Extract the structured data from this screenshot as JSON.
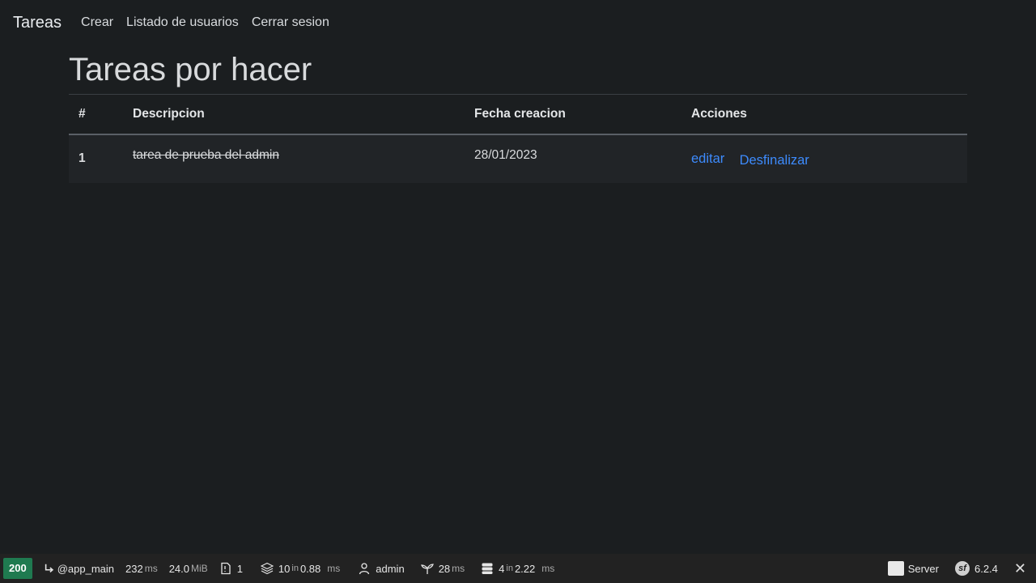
{
  "navbar": {
    "brand": "Tareas",
    "links": [
      "Crear",
      "Listado de usuarios",
      "Cerrar sesion"
    ]
  },
  "main": {
    "title": "Tareas por hacer",
    "table": {
      "headers": [
        "#",
        "Descripcion",
        "Fecha creacion",
        "Acciones"
      ],
      "rows": [
        {
          "id": "1",
          "description": "tarea de prueba del admin",
          "date": "28/01/2023",
          "actions": [
            "editar",
            "Desfinalizar"
          ]
        }
      ]
    }
  },
  "toolbar": {
    "status": "200",
    "route": "@app_main",
    "time_value": "232",
    "time_unit": "ms",
    "memory_value": "24.0",
    "memory_unit": "MiB",
    "logs_count": "1",
    "cache_value": "10",
    "cache_in": "in",
    "cache_time": "0.88",
    "cache_unit": "ms",
    "user": "admin",
    "twig_value": "28",
    "twig_unit": "ms",
    "db_value": "4",
    "db_in": "in",
    "db_time": "2.22",
    "db_unit": "ms",
    "server_label": "Server",
    "symfony_version": "6.2.4",
    "colors": {
      "status": "#1f7a50",
      "link": "#3d8bfd"
    }
  }
}
